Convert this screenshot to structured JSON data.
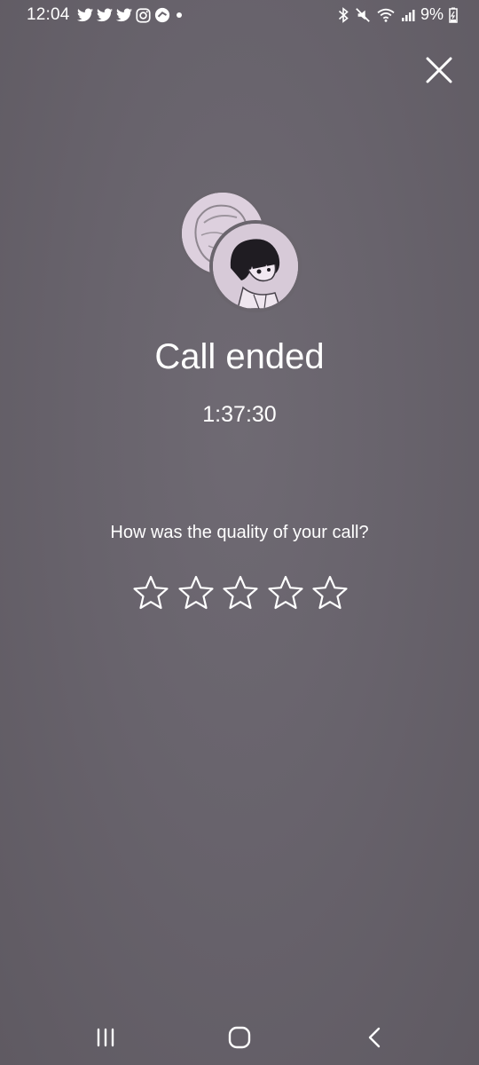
{
  "status_bar": {
    "time": "12:04",
    "left_icons": [
      "twitter-icon",
      "twitter-icon",
      "twitter-icon",
      "instagram-icon",
      "app-icon",
      "dot-icon"
    ],
    "right_icons": [
      "bluetooth-icon",
      "mute-icon",
      "wifi-icon",
      "signal-icon"
    ],
    "battery": "9%"
  },
  "call": {
    "title": "Call ended",
    "duration": "1:37:30"
  },
  "rating": {
    "question": "How was the quality of your call?",
    "max_stars": 5,
    "selected": 0
  },
  "nav": {
    "items": [
      "recents-button",
      "home-button",
      "back-button"
    ]
  },
  "colors": {
    "background": "#68636c",
    "text": "#ffffff",
    "avatar_bg": "#d9ccda"
  }
}
